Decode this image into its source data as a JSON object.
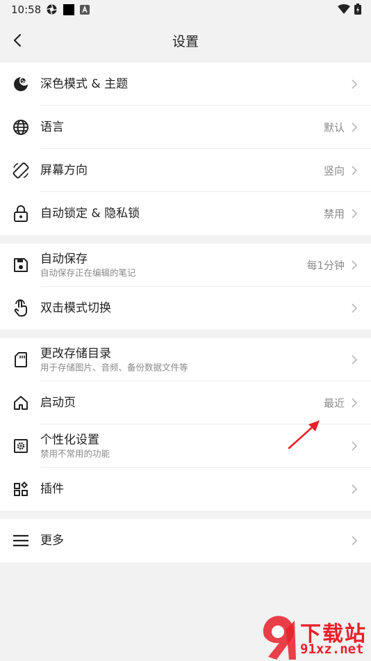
{
  "status_bar": {
    "time": "10:58"
  },
  "header": {
    "title": "设置"
  },
  "groups": [
    {
      "items": [
        {
          "label": "深色模式 & 主题",
          "value": ""
        },
        {
          "label": "语言",
          "value": "默认"
        },
        {
          "label": "屏幕方向",
          "value": "竖向"
        },
        {
          "label": "自动锁定 & 隐私锁",
          "value": "禁用"
        }
      ]
    },
    {
      "items": [
        {
          "label": "自动保存",
          "sub": "自动保存正在编辑的笔记",
          "value": "每1分钟"
        },
        {
          "label": "双击模式切换",
          "value": ""
        }
      ]
    },
    {
      "items": [
        {
          "label": "更改存储目录",
          "sub": "用于存储图片、音频、备份数据文件等",
          "value": ""
        },
        {
          "label": "启动页",
          "value": "最近"
        },
        {
          "label": "个性化设置",
          "sub": "禁用不常用的功能",
          "value": ""
        },
        {
          "label": "插件",
          "value": ""
        }
      ]
    },
    {
      "items": [
        {
          "label": "更多",
          "value": ""
        }
      ]
    }
  ],
  "watermark": {
    "line1": "下载站",
    "line2": "91xz.net"
  },
  "colors": {
    "accent_red": "#e8202a",
    "background": "#f2f2f2",
    "icon": "#222222"
  }
}
